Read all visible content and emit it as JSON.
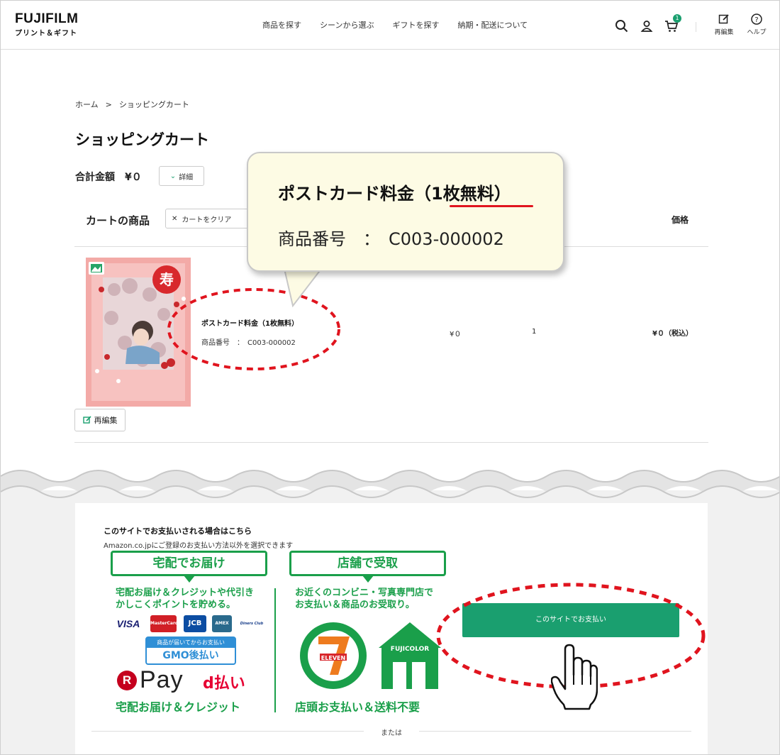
{
  "header": {
    "logo_main": "FUJIFILM",
    "logo_sub": "プリント＆ギフト",
    "nav": [
      "商品を探す",
      "シーンから選ぶ",
      "ギフトを探す",
      "納期・配送について"
    ],
    "cart_count": "1",
    "reedit_label": "再編集",
    "help_label": "ヘルプ"
  },
  "breadcrumb": {
    "home": "ホーム",
    "sep": ">",
    "current": "ショッピングカート"
  },
  "page_title": "ショッピングカート",
  "total": {
    "label": "合計金額",
    "amount": "¥０",
    "detail_label": "詳細"
  },
  "cart": {
    "heading": "カートの商品",
    "clear_label": "カートをクリア",
    "price_header": "価格",
    "item": {
      "name": "ポストカード料金（1枚無料）",
      "code": "商品番号　：　C003-000002",
      "unit_price": "¥０",
      "quantity": "1",
      "subtotal": "¥０（税込）",
      "stamp": "寿"
    },
    "reedit_label": "再編集"
  },
  "callout": {
    "name": "ポストカード料金（1枚無料）",
    "code": "商品番号　：　C003-000002"
  },
  "payment": {
    "title": "このサイトでお支払いされる場合はこちら",
    "subtitle": "Amazon.co.jpにご登録のお支払い方法以外を選択できます",
    "delivery_tag": "宅配でお届け",
    "delivery_desc_1": "宅配お届け＆クレジットや代引き",
    "delivery_desc_2": "かしこくポイントを貯める。",
    "cards": [
      "VISA",
      "MasterCard",
      "JCB",
      "AMEX",
      "Diners Club"
    ],
    "gmo_top": "商品が届いてからお支払い",
    "gmo_main": "GMO後払い",
    "rpay": "Pay",
    "rpay_r": "R",
    "dpay": "d払い",
    "delivery_footer": "宅配お届け＆クレジット",
    "store_tag": "店舗で受取",
    "store_desc_1": "お近くのコンビニ・写真専門店で",
    "store_desc_2": "お支払い＆商品のお受取り。",
    "seven_label": "ELEVEN",
    "fujicolor_label": "FUJICOLOR",
    "store_footer": "店頭お支払い＆送料不要",
    "button_label": "このサイトでお支払い",
    "or_label": "または"
  },
  "colors": {
    "accent_green": "#1a9f6f",
    "promo_green": "#1a9f4a",
    "highlight_red": "#e0141e"
  }
}
